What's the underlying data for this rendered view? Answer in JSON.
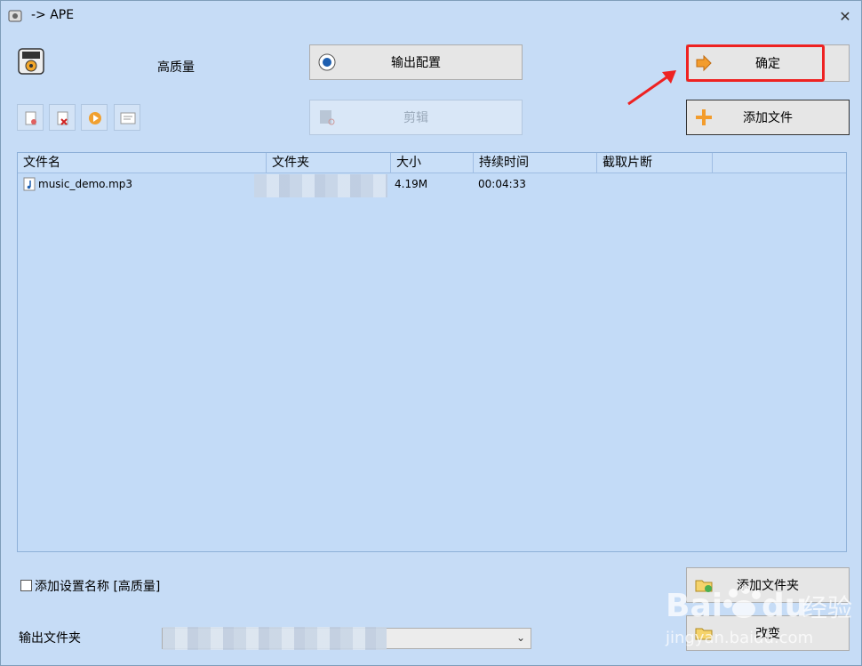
{
  "window": {
    "title": "-> APE",
    "close_glyph": "✕"
  },
  "header": {
    "quality_label": "高质量",
    "format_icon": "ape-format-icon"
  },
  "buttons": {
    "output_config": "输出配置",
    "edit": "剪辑",
    "ok": "确定",
    "add_file": "添加文件",
    "add_folder": "添加文件夹",
    "change": "改变"
  },
  "toolbar": [
    {
      "icon": "clear-list-icon"
    },
    {
      "icon": "remove-file-icon"
    },
    {
      "icon": "play-icon"
    },
    {
      "icon": "info-icon"
    }
  ],
  "file_list": {
    "columns": [
      "文件名",
      "文件夹",
      "大小",
      "持续时间",
      "截取片断"
    ],
    "rows": [
      {
        "name": "music_demo.mp3",
        "folder": "",
        "size": "4.19M",
        "duration": "00:04:33",
        "clip": ""
      }
    ]
  },
  "options": {
    "add_setting_name_label": "添加设置名称 [高质量]",
    "add_setting_name_checked": false
  },
  "output": {
    "label": "输出文件夹",
    "folder_value": ""
  },
  "watermark": {
    "brand": "Baidu经验",
    "url": "jingyan.baidu.com"
  },
  "colors": {
    "highlight": "#ee2222",
    "background": "#c6dcf6"
  }
}
